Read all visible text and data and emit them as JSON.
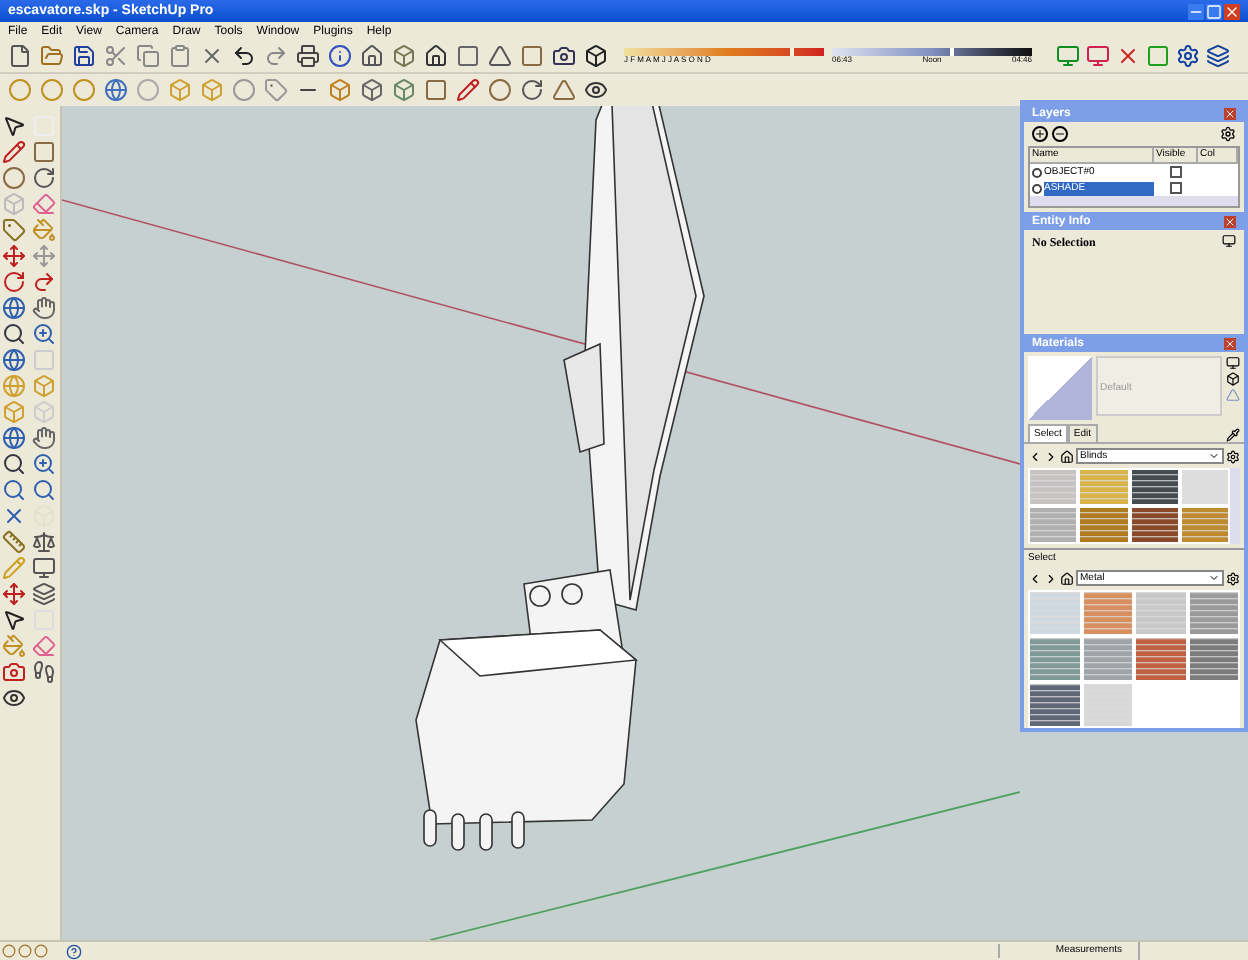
{
  "window": {
    "title": "escavatore.skp - SketchUp Pro"
  },
  "menu": [
    "File",
    "Edit",
    "View",
    "Camera",
    "Draw",
    "Tools",
    "Window",
    "Plugins",
    "Help"
  ],
  "shadow_settings": {
    "months": "J F M A M J J A S O N D",
    "times": [
      "06:43",
      "Noon",
      "04:46"
    ],
    "date_slider": {
      "level": 0.85
    },
    "time_slider": {
      "level": 0.6
    }
  },
  "layers": {
    "title": "Layers",
    "columns": [
      "Name",
      "Visible",
      "Col"
    ],
    "rows": [
      {
        "name": "OBJECT#0",
        "selected": false,
        "visible": false
      },
      {
        "name": "ASHADE",
        "selected": true,
        "visible": false
      }
    ]
  },
  "entity_info": {
    "title": "Entity Info",
    "text": "No Selection"
  },
  "materials": {
    "title": "Materials",
    "name": "Default",
    "tabs": [
      {
        "label": "Select",
        "selected": true
      },
      {
        "label": "Edit",
        "selected": false
      }
    ],
    "library": "Blinds",
    "secondary": {
      "label": "Select",
      "library": "Metal"
    }
  },
  "status_bar": {
    "label": "Measurements"
  }
}
